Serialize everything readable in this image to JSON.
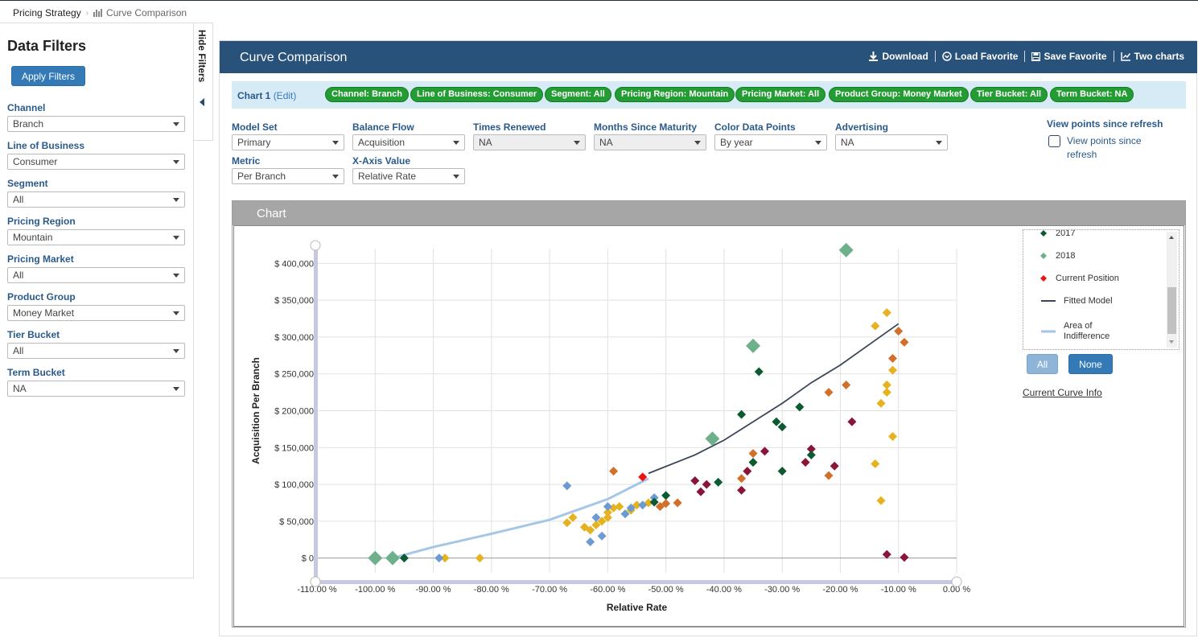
{
  "breadcrumb": {
    "root": "Pricing Strategy",
    "current": "Curve Comparison"
  },
  "sidebar": {
    "title": "Data Filters",
    "apply_label": "Apply Filters",
    "hide_label": "Hide Filters",
    "filters": [
      {
        "label": "Channel",
        "value": "Branch"
      },
      {
        "label": "Line of Business",
        "value": "Consumer"
      },
      {
        "label": "Segment",
        "value": "All"
      },
      {
        "label": "Pricing Region",
        "value": "Mountain"
      },
      {
        "label": "Pricing Market",
        "value": "All"
      },
      {
        "label": "Product Group",
        "value": "Money Market"
      },
      {
        "label": "Tier Bucket",
        "value": "All"
      },
      {
        "label": "Term Bucket",
        "value": "NA"
      }
    ]
  },
  "panel": {
    "title": "Curve Comparison",
    "actions": {
      "download": "Download",
      "load": "Load Favorite",
      "save": "Save Favorite",
      "two": "Two charts"
    },
    "chart_label": "Chart 1",
    "edit_label": "(Edit)",
    "chips": [
      "Channel: Branch",
      "Line of Business: Consumer",
      "Segment: All",
      "Pricing Region: Mountain",
      "Pricing Market: All",
      "Product Group: Money Market",
      "Tier Bucket: All",
      "Term Bucket: NA"
    ],
    "controls": {
      "model_set": {
        "label": "Model Set",
        "value": "Primary"
      },
      "balance_flow": {
        "label": "Balance Flow",
        "value": "Acquisition"
      },
      "times_renewed": {
        "label": "Times Renewed",
        "value": "NA"
      },
      "months_since": {
        "label": "Months Since Maturity",
        "value": "NA"
      },
      "color_points": {
        "label": "Color Data Points",
        "value": "By year"
      },
      "advertising": {
        "label": "Advertising",
        "value": "NA"
      },
      "metric": {
        "label": "Metric",
        "value": "Per Branch"
      },
      "x_axis": {
        "label": "X-Axis Value",
        "value": "Relative Rate"
      }
    },
    "view_points": {
      "title": "View points since refresh",
      "checkbox_label": "View points since refresh",
      "checked": false
    },
    "chart_section_title": "Chart"
  },
  "legend": {
    "items": [
      {
        "label": "2017",
        "color": "#0c5a32",
        "kind": "diamond"
      },
      {
        "label": "2018",
        "color": "#6fb08c",
        "kind": "diamond"
      },
      {
        "label": "Current Position",
        "color": "#ee1111",
        "kind": "diamond"
      },
      {
        "label": "Fitted Model",
        "color": "#3b4658",
        "kind": "line"
      },
      {
        "label": "Area of Indifference",
        "color": "#a6c6e8",
        "kind": "line"
      }
    ],
    "all_label": "All",
    "none_label": "None",
    "curve_info_label": "Current Curve Info"
  },
  "chart_data": {
    "type": "scatter",
    "xlabel": "Relative Rate",
    "ylabel": "Acquisition Per Branch",
    "xlim": [
      -110,
      0
    ],
    "ylim": [
      -20000,
      420000
    ],
    "x_ticks": [
      -110,
      -100,
      -90,
      -80,
      -70,
      -60,
      -50,
      -40,
      -30,
      -20,
      -10,
      0
    ],
    "x_tick_labels": [
      "-110.00 %",
      "-100.00 %",
      "-90.00 %",
      "-80.00 %",
      "-70.00 %",
      "-60.00 %",
      "-50.00 %",
      "-40.00 %",
      "-30.00 %",
      "-20.00 %",
      "-10.00 %",
      "0.00 %"
    ],
    "y_ticks": [
      0,
      50000,
      100000,
      150000,
      200000,
      250000,
      300000,
      350000,
      400000
    ],
    "y_tick_labels": [
      "$ 0",
      "$ 50,000",
      "$ 100,000",
      "$ 150,000",
      "$ 200,000",
      "$ 250,000",
      "$ 300,000",
      "$ 350,000",
      "$ 400,000"
    ],
    "grid": true,
    "colors": {
      "yellow": "#e6b21f",
      "orange": "#d2702a",
      "blue": "#6b9bd0",
      "maroon": "#8a1538",
      "dkgreen": "#0c5a32",
      "ltgreen": "#6fb08c",
      "red": "#ee1111",
      "fitted": "#3b4658",
      "indiff": "#a6c6e8"
    },
    "series": [
      {
        "name": "Fitted Model",
        "type": "line",
        "points": [
          [
            -53,
            115000
          ],
          [
            -45,
            140000
          ],
          [
            -40,
            160000
          ],
          [
            -35,
            185000
          ],
          [
            -30,
            210000
          ],
          [
            -25,
            238000
          ],
          [
            -20,
            262000
          ],
          [
            -15,
            290000
          ],
          [
            -10,
            318000
          ]
        ]
      },
      {
        "name": "Area of Indifference",
        "type": "line",
        "points": [
          [
            -97,
            0
          ],
          [
            -90,
            15000
          ],
          [
            -80,
            33000
          ],
          [
            -70,
            52000
          ],
          [
            -60,
            80000
          ],
          [
            -53,
            108000
          ]
        ]
      },
      {
        "color": "yellow",
        "points": [
          [
            -88,
            0
          ],
          [
            -82,
            0
          ],
          [
            -67,
            48000
          ],
          [
            -66,
            55000
          ],
          [
            -64,
            42000
          ],
          [
            -63,
            38000
          ],
          [
            -62,
            45000
          ],
          [
            -61,
            50000
          ],
          [
            -60,
            55000
          ],
          [
            -60,
            62000
          ],
          [
            -59,
            68000
          ],
          [
            -58,
            70000
          ],
          [
            -56,
            65000
          ],
          [
            -55,
            72000
          ],
          [
            -53,
            75000
          ],
          [
            -14,
            315000
          ],
          [
            -12,
            333000
          ],
          [
            -11,
            255000
          ],
          [
            -12,
            235000
          ],
          [
            -12,
            225000
          ],
          [
            -13,
            210000
          ],
          [
            -11,
            165000
          ],
          [
            -14,
            128000
          ],
          [
            -13,
            78000
          ]
        ]
      },
      {
        "color": "orange",
        "points": [
          [
            -59,
            118000
          ],
          [
            -51,
            70000
          ],
          [
            -50,
            74000
          ],
          [
            -48,
            75000
          ],
          [
            -37,
            108000
          ],
          [
            -35,
            142000
          ],
          [
            -22,
            225000
          ],
          [
            -19,
            235000
          ],
          [
            -22,
            112000
          ],
          [
            -10,
            308000
          ],
          [
            -9,
            293000
          ],
          [
            -11,
            271000
          ]
        ]
      },
      {
        "color": "blue",
        "points": [
          [
            -89,
            0
          ],
          [
            -67,
            98000
          ],
          [
            -63,
            22000
          ],
          [
            -61,
            30000
          ],
          [
            -62,
            55000
          ],
          [
            -60,
            70000
          ],
          [
            -57,
            60000
          ],
          [
            -56,
            68000
          ],
          [
            -54,
            72000
          ],
          [
            -52,
            82000
          ]
        ]
      },
      {
        "color": "maroon",
        "points": [
          [
            -45,
            105000
          ],
          [
            -44,
            90000
          ],
          [
            -43,
            100000
          ],
          [
            -37,
            92000
          ],
          [
            -36,
            118000
          ],
          [
            -33,
            145000
          ],
          [
            -26,
            130000
          ],
          [
            -25,
            148000
          ],
          [
            -21,
            125000
          ],
          [
            -18,
            185000
          ],
          [
            -12,
            5000
          ],
          [
            -9,
            1000
          ]
        ]
      },
      {
        "color": "dkgreen",
        "points": [
          [
            -95,
            0
          ],
          [
            -52,
            76000
          ],
          [
            -50,
            85000
          ],
          [
            -41,
            103000
          ],
          [
            -37,
            195000
          ],
          [
            -35,
            130000
          ],
          [
            -34,
            253000
          ],
          [
            -31,
            185000
          ],
          [
            -30,
            178000
          ],
          [
            -30,
            118000
          ],
          [
            -27,
            205000
          ],
          [
            -25,
            140000
          ]
        ]
      },
      {
        "color": "ltgreen",
        "points": [
          [
            -100,
            0
          ],
          [
            -97,
            0
          ],
          [
            -42,
            162000
          ],
          [
            -35,
            288000
          ],
          [
            -19,
            418000
          ]
        ]
      },
      {
        "color": "red",
        "points": [
          [
            -54,
            110000
          ]
        ]
      }
    ]
  }
}
